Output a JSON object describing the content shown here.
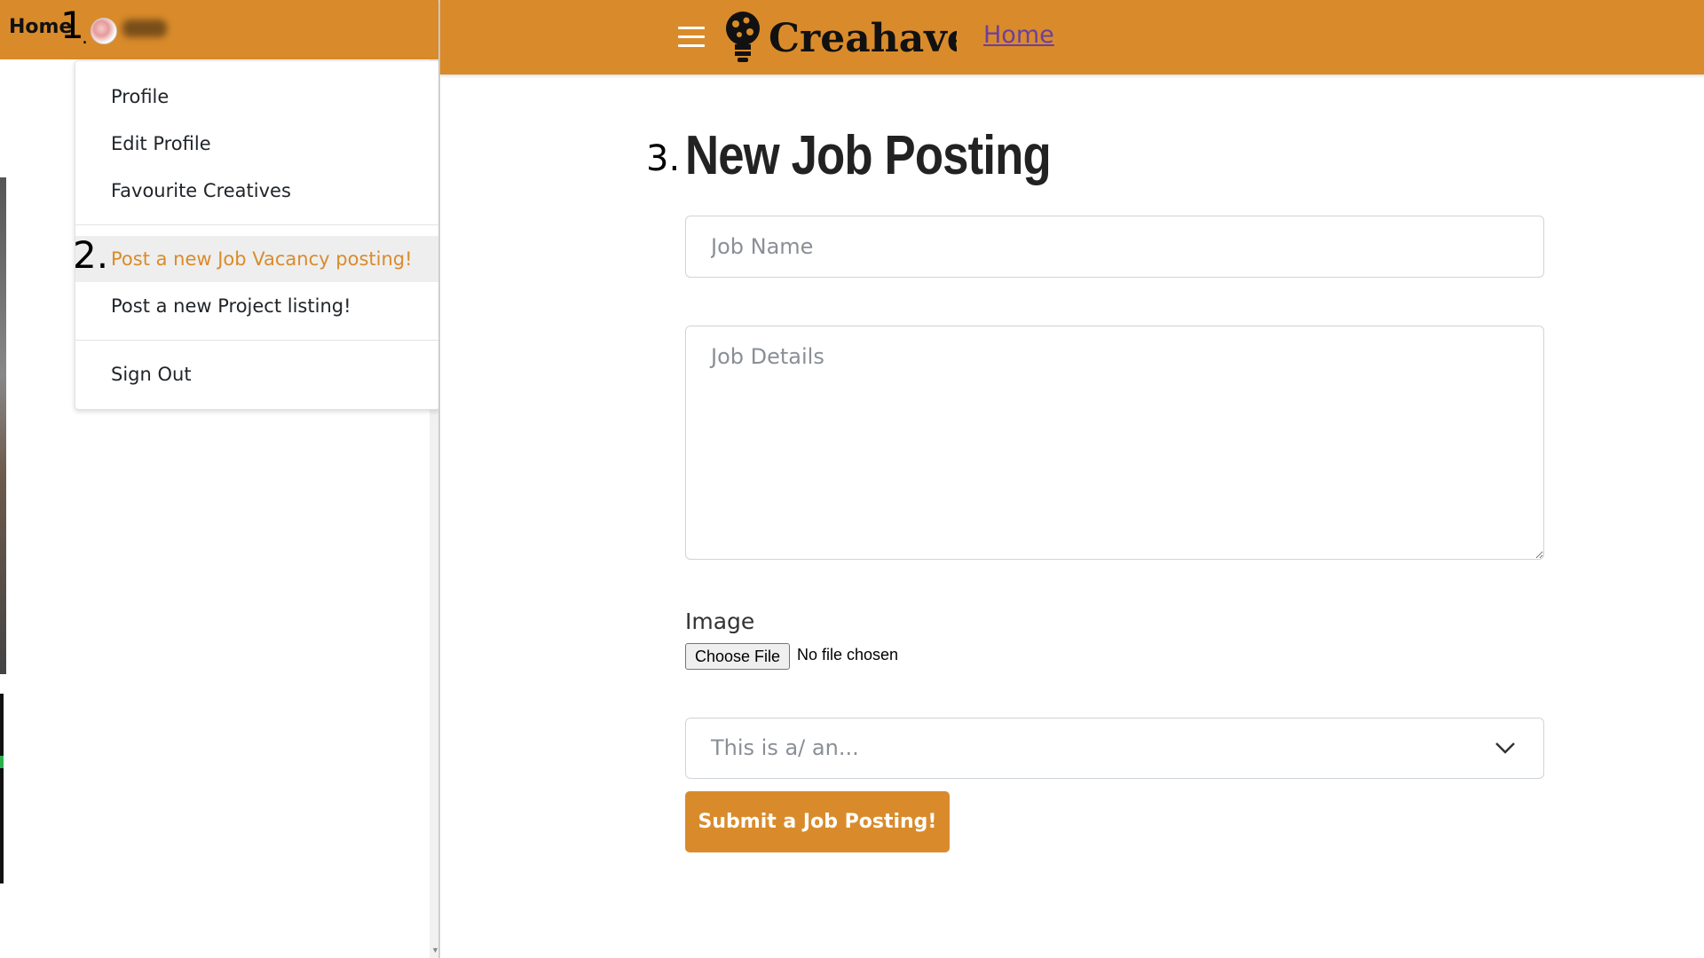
{
  "left_window": {
    "home_label": "Home",
    "step1": "1",
    "step1_dot": ".",
    "step2": "2.",
    "dropdown": {
      "items": [
        {
          "label": "Profile"
        },
        {
          "label": "Edit Profile"
        },
        {
          "label": "Favourite Creatives"
        },
        {
          "label": "Post a new Job Vacancy posting!"
        },
        {
          "label": "Post a new Project listing!"
        },
        {
          "label": "Sign Out"
        }
      ]
    }
  },
  "navbar": {
    "brand": "Creahaven",
    "home_link": "Home",
    "icons": [
      "hamburger-menu-icon",
      "lightbulb-logo-icon"
    ]
  },
  "main": {
    "step3": "3.",
    "title": "New Job Posting",
    "job_name_placeholder": "Job Name",
    "job_details_placeholder": "Job Details",
    "image_label": "Image",
    "file_button": "Choose File",
    "file_status": "No file chosen",
    "type_select": "This is a/ an...",
    "submit_label": "Submit a Job Posting!"
  },
  "colors": {
    "accent": "#D98B2B",
    "link": "#6b3fa0"
  }
}
